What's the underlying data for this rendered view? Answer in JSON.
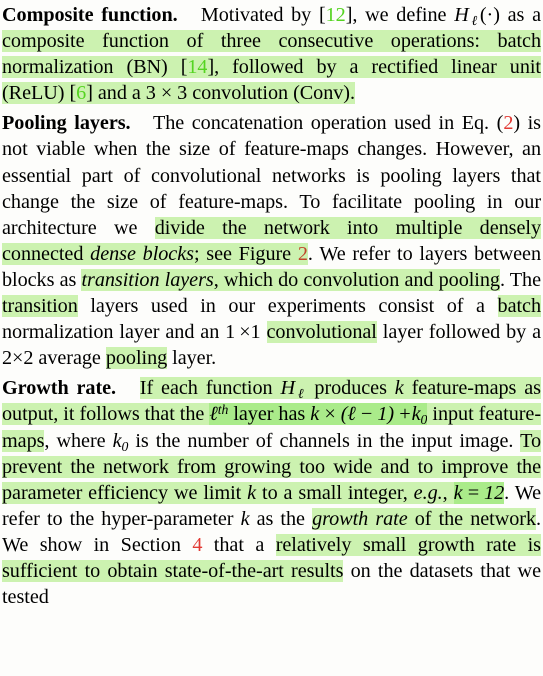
{
  "document": {
    "type": "academic-paper-excerpt",
    "background_color": "#fdfdfb",
    "text_color": "#000000",
    "highlight_color_light": "#ccf2b0",
    "highlight_color_strong": "#aaeb8a",
    "citation_green": "#55d421",
    "citation_red": "#e23a34",
    "citation_darkred": "#c0462a"
  },
  "paragraphs": [
    {
      "id": "composite-function",
      "lead": "Composite function.",
      "segments": [
        {
          "text": "Motivated by [",
          "style": "plain"
        },
        {
          "text": "12",
          "style": "cite-green"
        },
        {
          "text": "], we define ",
          "style": "plain"
        },
        {
          "text": "H",
          "style": "math"
        },
        {
          "text": "ℓ",
          "style": "math-sub"
        },
        {
          "text": "(·) as a ",
          "style": "plain"
        },
        {
          "text": "composite function of three consecutive operations: batch normalization (BN) [",
          "style": "highlight"
        },
        {
          "text": "14",
          "style": "cite-green-hl"
        },
        {
          "text": "], followed by a rectified linear unit (ReLU) [",
          "style": "highlight"
        },
        {
          "text": "6",
          "style": "cite-green-hl"
        },
        {
          "text": "] and a 3 × 3 convolution (Conv).",
          "style": "highlight"
        }
      ],
      "plain_text": "Composite function. Motivated by [12], we define Hℓ(·) as a composite function of three consecutive operations: batch normalization (BN) [14], followed by a rectified linear unit (ReLU) [6] and a 3 × 3 convolution (Conv)."
    },
    {
      "id": "pooling-layers",
      "lead": "Pooling layers.",
      "segments": [
        {
          "text": "The concatenation operation used in Eq. (",
          "style": "plain"
        },
        {
          "text": "2",
          "style": "cite-red"
        },
        {
          "text": ") is not viable when the size of feature-maps changes. However, an essential part of convolutional networks is pooling layers that change the size of feature-maps. To facilitate pooling in our architecture we ",
          "style": "plain"
        },
        {
          "text": "divide the network into multiple densely connected ",
          "style": "highlight"
        },
        {
          "text": "dense blocks",
          "style": "highlight-italic"
        },
        {
          "text": "; see Figure ",
          "style": "highlight"
        },
        {
          "text": "2",
          "style": "cite-darkred-hl"
        },
        {
          "text": ". We refer to layers between blocks as ",
          "style": "plain"
        },
        {
          "text": "transition layers",
          "style": "highlight-italic"
        },
        {
          "text": ", which do convolution and pooling",
          "style": "highlight"
        },
        {
          "text": ". The ",
          "style": "plain"
        },
        {
          "text": "transition",
          "style": "highlight"
        },
        {
          "text": " layers used in our experiments consist of a ",
          "style": "plain"
        },
        {
          "text": "batch",
          "style": "highlight"
        },
        {
          "text": " normalization layer and an 1×1 ",
          "style": "plain"
        },
        {
          "text": "convolutional",
          "style": "highlight"
        },
        {
          "text": " layer followed by a 2×2 average ",
          "style": "plain"
        },
        {
          "text": "pooling",
          "style": "highlight"
        },
        {
          "text": " layer.",
          "style": "plain"
        }
      ],
      "plain_text": "Pooling layers. The concatenation operation used in Eq. (2) is not viable when the size of feature-maps changes. However, an essential part of convolutional networks is pooling layers that change the size of feature-maps. To facilitate pooling in our architecture we divide the network into multiple densely connected dense blocks; see Figure 2. We refer to layers between blocks as transition layers, which do convolution and pooling. The transition layers used in our experiments consist of a batch normalization layer and an 1×1 convolutional layer followed by a 2×2 average pooling layer."
    },
    {
      "id": "growth-rate",
      "lead": "Growth rate.",
      "segments": [
        {
          "text": "If each function ",
          "style": "highlight"
        },
        {
          "text": "Hℓ",
          "style": "highlight-math"
        },
        {
          "text": " produces ",
          "style": "highlight"
        },
        {
          "text": "k",
          "style": "highlight-math"
        },
        {
          "text": " feature-maps as output, it follows that the ",
          "style": "highlight"
        },
        {
          "text": "ℓth",
          "style": "highlight-math-strong"
        },
        {
          "text": " layer has ",
          "style": "highlight"
        },
        {
          "text": "k × (ℓ − 1) + k0",
          "style": "highlight-math-strong"
        },
        {
          "text": " input feature-maps",
          "style": "highlight"
        },
        {
          "text": ", where ",
          "style": "plain"
        },
        {
          "text": "k0",
          "style": "math"
        },
        {
          "text": " is the number of channels in the input image. ",
          "style": "plain"
        },
        {
          "text": "To prevent the network from growing too wide and to improve the parameter efficiency we limit ",
          "style": "highlight"
        },
        {
          "text": "k",
          "style": "highlight-math"
        },
        {
          "text": " to a small integer, ",
          "style": "highlight"
        },
        {
          "text": "e.g.,",
          "style": "highlight-italic"
        },
        {
          "text": " ",
          "style": "highlight"
        },
        {
          "text": "k = 12",
          "style": "highlight-math-strong"
        },
        {
          "text": ". We refer to the hyper-parameter ",
          "style": "plain"
        },
        {
          "text": "k",
          "style": "math"
        },
        {
          "text": " as the ",
          "style": "plain"
        },
        {
          "text": "growth rate",
          "style": "highlight-italic"
        },
        {
          "text": " of the network",
          "style": "highlight"
        },
        {
          "text": ". We show in Section ",
          "style": "plain"
        },
        {
          "text": "4",
          "style": "cite-red"
        },
        {
          "text": " that a ",
          "style": "plain"
        },
        {
          "text": "relatively small growth rate is sufficient to obtain state-of-the-art results",
          "style": "highlight"
        },
        {
          "text": " on the datasets that we tested",
          "style": "plain"
        }
      ],
      "plain_text": "Growth rate. If each function Hℓ produces k feature-maps as output, it follows that the ℓth layer has k × (ℓ − 1) + k0 input feature-maps, where k0 is the number of channels in the input image. To prevent the network from growing too wide and to improve the parameter efficiency we limit k to a small integer, e.g., k = 12. We refer to the hyper-parameter k as the growth rate of the network. We show in Section 4 that a relatively small growth rate is sufficient to obtain state-of-the-art results on the datasets that we tested"
    }
  ]
}
